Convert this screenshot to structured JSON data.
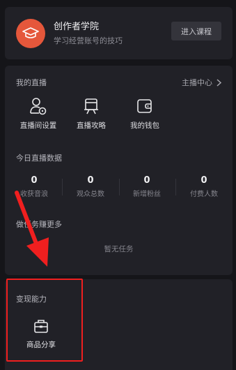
{
  "academy": {
    "title": "创作者学院",
    "subtitle": "学习经营账号的技巧",
    "course_button": "进入课程",
    "logo_icon": "graduation-cap-icon",
    "accent": "#e5573b"
  },
  "live": {
    "title": "我的直播",
    "host_center": "主播中心",
    "tools": [
      {
        "label": "直播间设置",
        "icon": "user-settings-icon"
      },
      {
        "label": "直播攻略",
        "icon": "guide-board-icon"
      },
      {
        "label": "我的钱包",
        "icon": "wallet-icon"
      }
    ]
  },
  "today": {
    "title": "今日直播数据",
    "stats": [
      {
        "value": "0",
        "label": "收获音浪"
      },
      {
        "value": "0",
        "label": "观众总数"
      },
      {
        "value": "0",
        "label": "新增粉丝"
      },
      {
        "value": "0",
        "label": "付费人数"
      }
    ]
  },
  "tasks": {
    "title": "做任务赚更多",
    "empty": "暂无任务"
  },
  "monetize": {
    "title": "变现能力",
    "items": [
      {
        "label": "商品分享",
        "icon": "briefcase-icon"
      }
    ]
  },
  "annotation": {
    "color": "#f01f1f"
  }
}
